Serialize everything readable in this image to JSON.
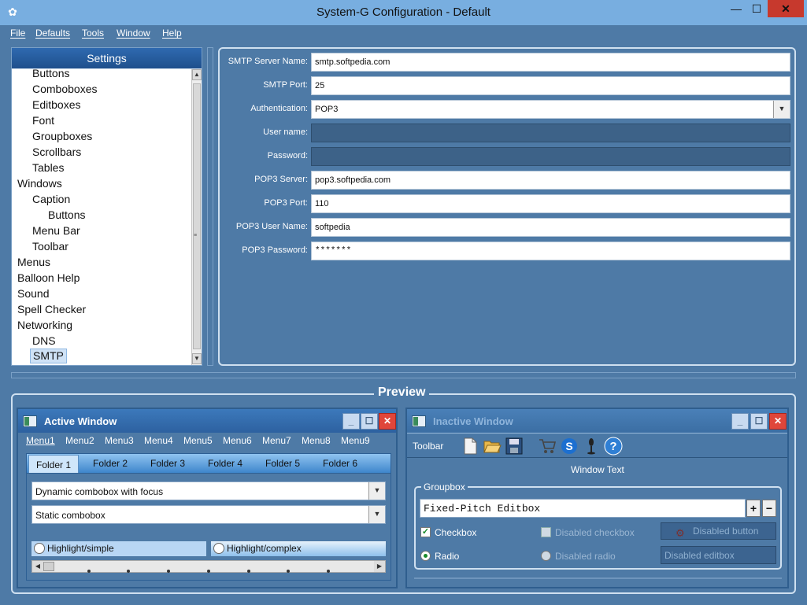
{
  "window": {
    "title": "System-G Configuration - Default",
    "minimize": "—",
    "maximize": "☐",
    "close": "✕",
    "app_icon": "gear-icon"
  },
  "menubar": [
    "File",
    "Defaults",
    "Tools",
    "Window",
    "Help"
  ],
  "settings": {
    "header": "Settings",
    "tree": [
      {
        "label": "Buttons",
        "level": 1
      },
      {
        "label": "Comboboxes",
        "level": 1
      },
      {
        "label": "Editboxes",
        "level": 1
      },
      {
        "label": "Font",
        "level": 1
      },
      {
        "label": "Groupboxes",
        "level": 1
      },
      {
        "label": "Scrollbars",
        "level": 1
      },
      {
        "label": "Tables",
        "level": 1
      },
      {
        "label": "Windows",
        "level": 0
      },
      {
        "label": "Caption",
        "level": 1
      },
      {
        "label": "Buttons",
        "level": 2
      },
      {
        "label": "Menu Bar",
        "level": 1
      },
      {
        "label": "Toolbar",
        "level": 1
      },
      {
        "label": "Menus",
        "level": 0
      },
      {
        "label": "Balloon Help",
        "level": 0
      },
      {
        "label": "Sound",
        "level": 0
      },
      {
        "label": "Spell Checker",
        "level": 0
      },
      {
        "label": "Networking",
        "level": 0
      },
      {
        "label": "DNS",
        "level": 1
      },
      {
        "label": "SMTP",
        "level": 1,
        "selected": true
      }
    ]
  },
  "smtp_form": {
    "fields": [
      {
        "label": "SMTP Server Name:",
        "value": "smtp.softpedia.com"
      },
      {
        "label": "SMTP Port:",
        "value": "25"
      },
      {
        "label": "Authentication:",
        "value": "POP3",
        "dropdown": true
      },
      {
        "label": "User name:",
        "value": "",
        "disabled": true
      },
      {
        "label": "Password:",
        "value": "",
        "disabled": true
      },
      {
        "label": "POP3 Server:",
        "value": "pop3.softpedia.com"
      },
      {
        "label": "POP3 Port:",
        "value": "110"
      },
      {
        "label": "POP3 User Name:",
        "value": "softpedia"
      },
      {
        "label": "POP3 Password:",
        "value": "*******"
      }
    ]
  },
  "preview": {
    "title": "Preview",
    "active_window": {
      "title": "Active Window",
      "menus": [
        "Menu1",
        "Menu2",
        "Menu3",
        "Menu4",
        "Menu5",
        "Menu6",
        "Menu7",
        "Menu8",
        "Menu9"
      ],
      "tabs": [
        "Folder 1",
        "Folder 2",
        "Folder 3",
        "Folder 4",
        "Folder 5",
        "Folder 6"
      ],
      "combo_focus": "Dynamic combobox with focus",
      "combo_static": "Static combobox",
      "highlight_simple": "Highlight/simple",
      "highlight_complex": "Highlight/complex"
    },
    "inactive_window": {
      "title": "Inactive Window",
      "toolbar_label": "Toolbar",
      "toolbar_icons": [
        "new-document-icon",
        "open-folder-icon",
        "save-icon",
        "shopping-cart-icon",
        "s-logo-icon",
        "microphone-icon",
        "help-icon"
      ],
      "window_text": "Window Text",
      "groupbox_title": "Groupbox",
      "fixed_edit": "Fixed-Pitch Editbox",
      "plus": "+",
      "minus": "−",
      "checkbox": "Checkbox",
      "checkbox_checked": true,
      "disabled_checkbox": "Disabled checkbox",
      "disabled_button": "Disabled button",
      "radio": "Radio",
      "disabled_radio": "Disabled radio",
      "disabled_edit": "Disabled editbox"
    }
  },
  "colors": {
    "background": "#4e7aa6",
    "titlebar": "#78aee0",
    "close_button": "#c7392d",
    "settings_header": "#2f6ab0",
    "selection": "#cfe2f6"
  }
}
